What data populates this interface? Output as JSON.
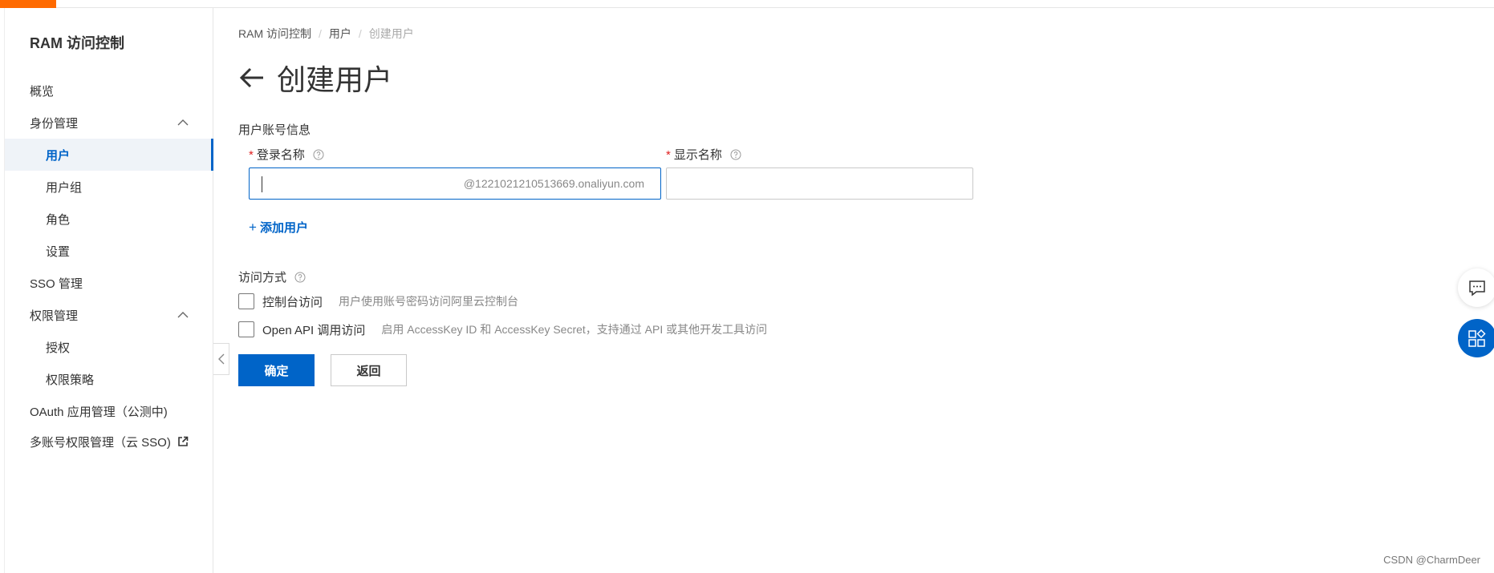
{
  "sidebar": {
    "title": "RAM 访问控制",
    "items": [
      {
        "label": "概览"
      },
      {
        "label": "身份管理"
      },
      {
        "label": "用户"
      },
      {
        "label": "用户组"
      },
      {
        "label": "角色"
      },
      {
        "label": "设置"
      },
      {
        "label": "SSO 管理"
      },
      {
        "label": "权限管理"
      },
      {
        "label": "授权"
      },
      {
        "label": "权限策略"
      },
      {
        "label": "OAuth 应用管理（公测中)"
      },
      {
        "label": "多账号权限管理（云 SSO)"
      }
    ]
  },
  "breadcrumb": {
    "items": [
      "RAM 访问控制",
      "用户",
      "创建用户"
    ],
    "separator": "/"
  },
  "page": {
    "title": "创建用户"
  },
  "form": {
    "section_account": "用户账号信息",
    "login_name_label": "登录名称",
    "login_name_value": "",
    "login_name_suffix": "@1221021210513669.onaliyun.com",
    "display_name_label": "显示名称",
    "display_name_value": "",
    "required_mark": "*",
    "add_user_label": "添加用户",
    "add_user_plus": "+",
    "section_access": "访问方式",
    "access_options": [
      {
        "label": "控制台访问",
        "desc": "用户使用账号密码访问阿里云控制台",
        "checked": false
      },
      {
        "label": "Open API 调用访问",
        "desc": "启用 AccessKey ID 和 AccessKey Secret，支持通过 API 或其他开发工具访问",
        "checked": false
      }
    ],
    "confirm_label": "确定",
    "back_label": "返回"
  },
  "watermark": "CSDN @CharmDeer",
  "colors": {
    "accent": "#0064c8",
    "brand": "#ff6a00",
    "required": "#e02020"
  },
  "icons": {
    "back": "arrow-left-icon",
    "help": "question-circle-icon",
    "collapse": "chevron-up-icon",
    "external": "external-link-icon",
    "chat": "chat-bubble-icon",
    "apps": "apps-grid-icon",
    "sidebar_toggle": "chevron-left-icon"
  }
}
